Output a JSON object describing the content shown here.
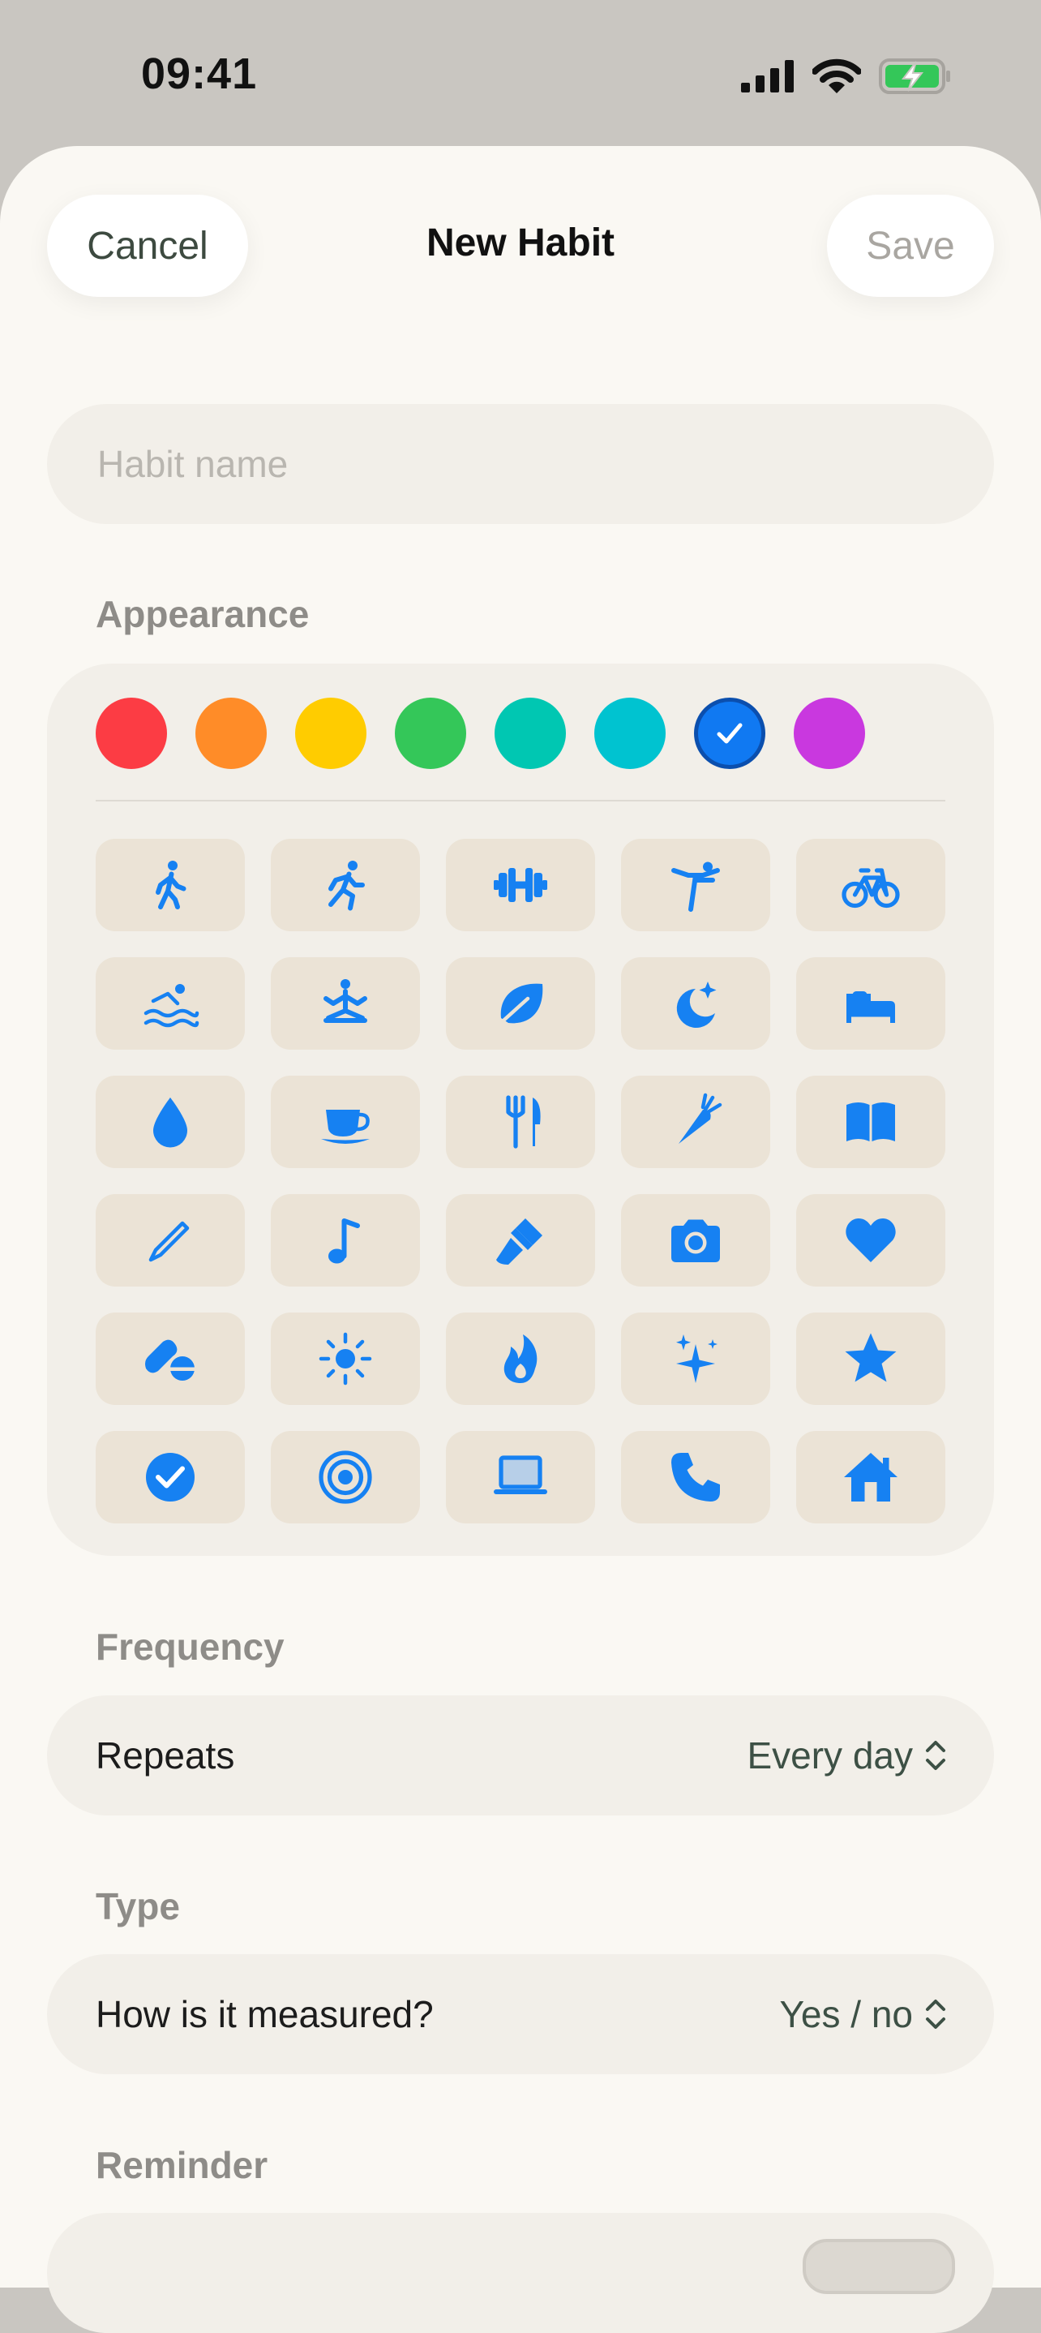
{
  "status_bar": {
    "time": "09:41"
  },
  "header": {
    "cancel_label": "Cancel",
    "title": "New Habit",
    "save_label": "Save"
  },
  "name_field": {
    "placeholder": "Habit name",
    "value": ""
  },
  "appearance": {
    "label": "Appearance",
    "colors": [
      "#fc3c44",
      "#ff8c28",
      "#ffcc00",
      "#34c759",
      "#00c7b2",
      "#00c3d0",
      "#1079f2",
      "#c938df"
    ],
    "selected_color_index": 6,
    "icon_color": "#1681f2",
    "icons": [
      "walking-icon",
      "running-icon",
      "dumbbell-icon",
      "yoga-icon",
      "bicycle-icon",
      "swimming-icon",
      "meditation-icon",
      "leaf-icon",
      "moon-stars-icon",
      "bed-icon",
      "water-drop-icon",
      "coffee-cup-icon",
      "fork-knife-icon",
      "carrot-icon",
      "book-icon",
      "pencil-icon",
      "music-note-icon",
      "paintbrush-icon",
      "camera-icon",
      "heart-icon",
      "pills-icon",
      "sun-icon",
      "flame-icon",
      "sparkles-icon",
      "star-icon",
      "checkmark-circle-icon",
      "target-icon",
      "laptop-icon",
      "phone-icon",
      "house-icon"
    ]
  },
  "frequency": {
    "label": "Frequency",
    "row_label": "Repeats",
    "value": "Every day"
  },
  "type": {
    "label": "Type",
    "row_label": "How is it measured?",
    "value": "Yes / no"
  },
  "reminder": {
    "label": "Reminder",
    "enabled": false
  }
}
